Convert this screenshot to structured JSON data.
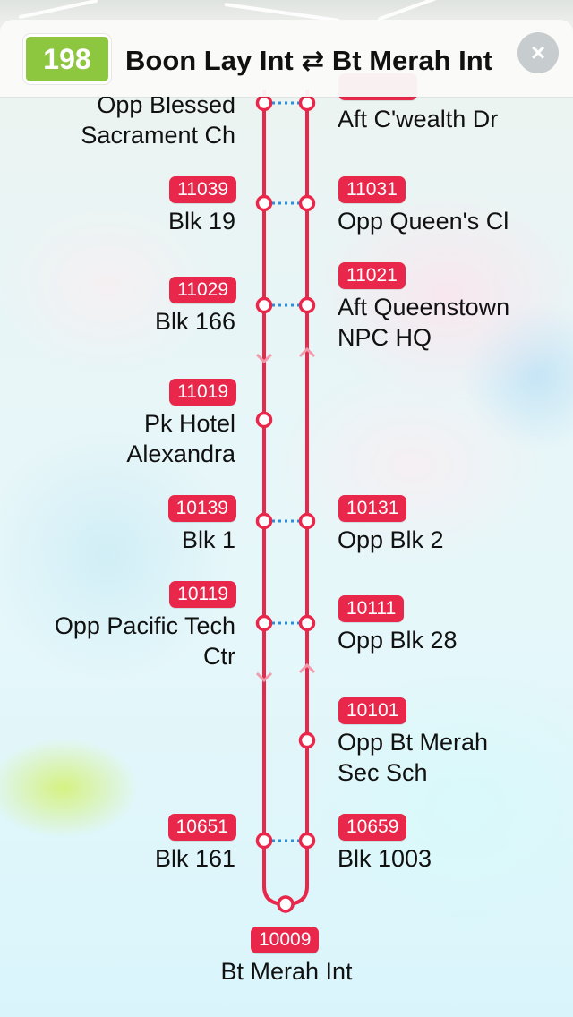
{
  "header": {
    "route_number": "198",
    "route_title": "Boon Lay Int ⇄ Bt Merah Int",
    "close_icon": "×",
    "badge_color": "#8dc63f"
  },
  "accent_color": "#e8274b",
  "stops": {
    "left": [
      {
        "code": "",
        "name_lines": [
          "Opp Blessed",
          "Sacrament Ch"
        ]
      },
      {
        "code": "11039",
        "name_lines": [
          "Blk 19"
        ]
      },
      {
        "code": "11029",
        "name_lines": [
          "Blk 166"
        ]
      },
      {
        "code": "11019",
        "name_lines": [
          "Pk Hotel",
          "Alexandra"
        ]
      },
      {
        "code": "10139",
        "name_lines": [
          "Blk 1"
        ]
      },
      {
        "code": "10119",
        "name_lines": [
          "Opp Pacific Tech",
          "Ctr"
        ]
      },
      {
        "code": "10651",
        "name_lines": [
          "Blk 161"
        ]
      }
    ],
    "right": [
      {
        "code": "",
        "name_lines": [
          "Aft C'wealth Dr"
        ]
      },
      {
        "code": "11031",
        "name_lines": [
          "Opp Queen's Cl"
        ]
      },
      {
        "code": "11021",
        "name_lines": [
          "Aft Queenstown",
          "NPC HQ"
        ]
      },
      {
        "code": "10131",
        "name_lines": [
          "Opp Blk 2"
        ]
      },
      {
        "code": "10111",
        "name_lines": [
          "Opp Blk 28"
        ]
      },
      {
        "code": "10101",
        "name_lines": [
          "Opp Bt Merah",
          "Sec Sch"
        ]
      },
      {
        "code": "10659",
        "name_lines": [
          "Blk 1003"
        ]
      }
    ],
    "terminal": {
      "code": "10009",
      "name": "Bt Merah Int"
    }
  }
}
